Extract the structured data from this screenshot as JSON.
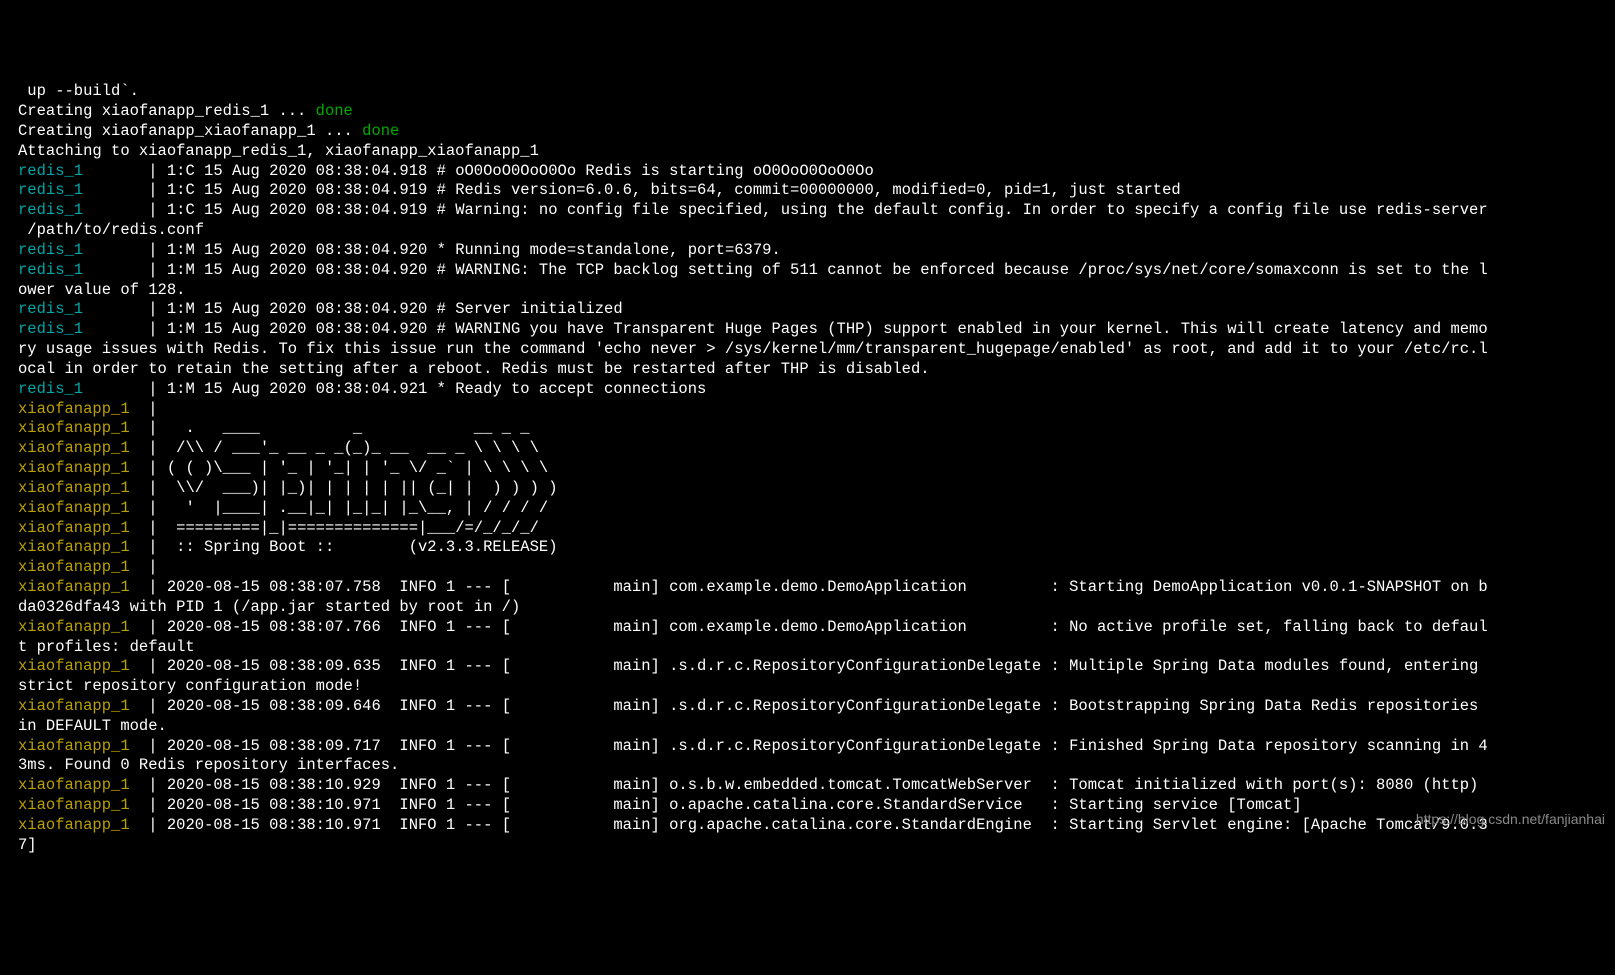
{
  "lines": [
    {
      "segments": [
        {
          "class": "white",
          "text": " up --build`."
        }
      ]
    },
    {
      "segments": [
        {
          "class": "white",
          "text": "Creating xiaofanapp_redis_1 ... "
        },
        {
          "class": "green",
          "text": "done"
        }
      ]
    },
    {
      "segments": [
        {
          "class": "white",
          "text": "Creating xiaofanapp_xiaofanapp_1 ... "
        },
        {
          "class": "green",
          "text": "done"
        }
      ]
    },
    {
      "segments": [
        {
          "class": "white",
          "text": "Attaching to xiaofanapp_redis_1, xiaofanapp_xiaofanapp_1"
        }
      ]
    },
    {
      "segments": [
        {
          "class": "cyan",
          "text": "redis_1       "
        },
        {
          "class": "pipe",
          "text": "|"
        },
        {
          "class": "white",
          "text": " 1:C 15 Aug 2020 08:38:04.918 # oO0OoO0OoO0Oo Redis is starting oO0OoO0OoO0Oo"
        }
      ]
    },
    {
      "segments": [
        {
          "class": "cyan",
          "text": "redis_1       "
        },
        {
          "class": "pipe",
          "text": "|"
        },
        {
          "class": "white",
          "text": " 1:C 15 Aug 2020 08:38:04.919 # Redis version=6.0.6, bits=64, commit=00000000, modified=0, pid=1, just started"
        }
      ]
    },
    {
      "segments": [
        {
          "class": "cyan",
          "text": "redis_1       "
        },
        {
          "class": "pipe",
          "text": "|"
        },
        {
          "class": "white",
          "text": " 1:C 15 Aug 2020 08:38:04.919 # Warning: no config file specified, using the default config. In order to specify a config file use redis-server"
        }
      ]
    },
    {
      "segments": [
        {
          "class": "white",
          "text": " /path/to/redis.conf"
        }
      ]
    },
    {
      "segments": [
        {
          "class": "cyan",
          "text": "redis_1       "
        },
        {
          "class": "pipe",
          "text": "|"
        },
        {
          "class": "white",
          "text": " 1:M 15 Aug 2020 08:38:04.920 * Running mode=standalone, port=6379."
        }
      ]
    },
    {
      "segments": [
        {
          "class": "cyan",
          "text": "redis_1       "
        },
        {
          "class": "pipe",
          "text": "|"
        },
        {
          "class": "white",
          "text": " 1:M 15 Aug 2020 08:38:04.920 # WARNING: The TCP backlog setting of 511 cannot be enforced because /proc/sys/net/core/somaxconn is set to the l"
        }
      ]
    },
    {
      "segments": [
        {
          "class": "white",
          "text": "ower value of 128."
        }
      ]
    },
    {
      "segments": [
        {
          "class": "cyan",
          "text": "redis_1       "
        },
        {
          "class": "pipe",
          "text": "|"
        },
        {
          "class": "white",
          "text": " 1:M 15 Aug 2020 08:38:04.920 # Server initialized"
        }
      ]
    },
    {
      "segments": [
        {
          "class": "cyan",
          "text": "redis_1       "
        },
        {
          "class": "pipe",
          "text": "|"
        },
        {
          "class": "white",
          "text": " 1:M 15 Aug 2020 08:38:04.920 # WARNING you have Transparent Huge Pages (THP) support enabled in your kernel. This will create latency and memo"
        }
      ]
    },
    {
      "segments": [
        {
          "class": "white",
          "text": "ry usage issues with Redis. To fix this issue run the command 'echo never > /sys/kernel/mm/transparent_hugepage/enabled' as root, and add it to your /etc/rc.l"
        }
      ]
    },
    {
      "segments": [
        {
          "class": "white",
          "text": "ocal in order to retain the setting after a reboot. Redis must be restarted after THP is disabled."
        }
      ]
    },
    {
      "segments": [
        {
          "class": "cyan",
          "text": "redis_1       "
        },
        {
          "class": "pipe",
          "text": "|"
        },
        {
          "class": "white",
          "text": " 1:M 15 Aug 2020 08:38:04.921 * Ready to accept connections"
        }
      ]
    },
    {
      "segments": [
        {
          "class": "yellow",
          "text": "xiaofanapp_1  "
        },
        {
          "class": "pipe",
          "text": "|"
        }
      ]
    },
    {
      "segments": [
        {
          "class": "yellow",
          "text": "xiaofanapp_1  "
        },
        {
          "class": "pipe",
          "text": "|"
        },
        {
          "class": "white",
          "text": "   .   ____          _            __ _ _"
        }
      ]
    },
    {
      "segments": [
        {
          "class": "yellow",
          "text": "xiaofanapp_1  "
        },
        {
          "class": "pipe",
          "text": "|"
        },
        {
          "class": "white",
          "text": "  /\\\\ / ___'_ __ _ _(_)_ __  __ _ \\ \\ \\ \\"
        }
      ]
    },
    {
      "segments": [
        {
          "class": "yellow",
          "text": "xiaofanapp_1  "
        },
        {
          "class": "pipe",
          "text": "|"
        },
        {
          "class": "white",
          "text": " ( ( )\\___ | '_ | '_| | '_ \\/ _` | \\ \\ \\ \\"
        }
      ]
    },
    {
      "segments": [
        {
          "class": "yellow",
          "text": "xiaofanapp_1  "
        },
        {
          "class": "pipe",
          "text": "|"
        },
        {
          "class": "white",
          "text": "  \\\\/  ___)| |_)| | | | | || (_| |  ) ) ) )"
        }
      ]
    },
    {
      "segments": [
        {
          "class": "yellow",
          "text": "xiaofanapp_1  "
        },
        {
          "class": "pipe",
          "text": "|"
        },
        {
          "class": "white",
          "text": "   '  |____| .__|_| |_|_| |_\\__, | / / / /"
        }
      ]
    },
    {
      "segments": [
        {
          "class": "yellow",
          "text": "xiaofanapp_1  "
        },
        {
          "class": "pipe",
          "text": "|"
        },
        {
          "class": "white",
          "text": "  =========|_|==============|___/=/_/_/_/"
        }
      ]
    },
    {
      "segments": [
        {
          "class": "yellow",
          "text": "xiaofanapp_1  "
        },
        {
          "class": "pipe",
          "text": "|"
        },
        {
          "class": "white",
          "text": "  :: Spring Boot ::        (v2.3.3.RELEASE)"
        }
      ]
    },
    {
      "segments": [
        {
          "class": "yellow",
          "text": "xiaofanapp_1  "
        },
        {
          "class": "pipe",
          "text": "|"
        }
      ]
    },
    {
      "segments": [
        {
          "class": "yellow",
          "text": "xiaofanapp_1  "
        },
        {
          "class": "pipe",
          "text": "|"
        },
        {
          "class": "white",
          "text": " 2020-08-15 08:38:07.758  INFO 1 --- [           main] com.example.demo.DemoApplication         : Starting DemoApplication v0.0.1-SNAPSHOT on b"
        }
      ]
    },
    {
      "segments": [
        {
          "class": "white",
          "text": "da0326dfa43 with PID 1 (/app.jar started by root in /)"
        }
      ]
    },
    {
      "segments": [
        {
          "class": "yellow",
          "text": "xiaofanapp_1  "
        },
        {
          "class": "pipe",
          "text": "|"
        },
        {
          "class": "white",
          "text": " 2020-08-15 08:38:07.766  INFO 1 --- [           main] com.example.demo.DemoApplication         : No active profile set, falling back to defaul"
        }
      ]
    },
    {
      "segments": [
        {
          "class": "white",
          "text": "t profiles: default"
        }
      ]
    },
    {
      "segments": [
        {
          "class": "yellow",
          "text": "xiaofanapp_1  "
        },
        {
          "class": "pipe",
          "text": "|"
        },
        {
          "class": "white",
          "text": " 2020-08-15 08:38:09.635  INFO 1 --- [           main] .s.d.r.c.RepositoryConfigurationDelegate : Multiple Spring Data modules found, entering "
        }
      ]
    },
    {
      "segments": [
        {
          "class": "white",
          "text": "strict repository configuration mode!"
        }
      ]
    },
    {
      "segments": [
        {
          "class": "yellow",
          "text": "xiaofanapp_1  "
        },
        {
          "class": "pipe",
          "text": "|"
        },
        {
          "class": "white",
          "text": " 2020-08-15 08:38:09.646  INFO 1 --- [           main] .s.d.r.c.RepositoryConfigurationDelegate : Bootstrapping Spring Data Redis repositories "
        }
      ]
    },
    {
      "segments": [
        {
          "class": "white",
          "text": "in DEFAULT mode."
        }
      ]
    },
    {
      "segments": [
        {
          "class": "yellow",
          "text": "xiaofanapp_1  "
        },
        {
          "class": "pipe",
          "text": "|"
        },
        {
          "class": "white",
          "text": " 2020-08-15 08:38:09.717  INFO 1 --- [           main] .s.d.r.c.RepositoryConfigurationDelegate : Finished Spring Data repository scanning in 4"
        }
      ]
    },
    {
      "segments": [
        {
          "class": "white",
          "text": "3ms. Found 0 Redis repository interfaces."
        }
      ]
    },
    {
      "segments": [
        {
          "class": "yellow",
          "text": "xiaofanapp_1  "
        },
        {
          "class": "pipe",
          "text": "|"
        },
        {
          "class": "white",
          "text": " 2020-08-15 08:38:10.929  INFO 1 --- [           main] o.s.b.w.embedded.tomcat.TomcatWebServer  : Tomcat initialized with port(s): 8080 (http)"
        }
      ]
    },
    {
      "segments": [
        {
          "class": "yellow",
          "text": "xiaofanapp_1  "
        },
        {
          "class": "pipe",
          "text": "|"
        },
        {
          "class": "white",
          "text": " 2020-08-15 08:38:10.971  INFO 1 --- [           main] o.apache.catalina.core.StandardService   : Starting service [Tomcat]"
        }
      ]
    },
    {
      "segments": [
        {
          "class": "yellow",
          "text": "xiaofanapp_1  "
        },
        {
          "class": "pipe",
          "text": "|"
        },
        {
          "class": "white",
          "text": " 2020-08-15 08:38:10.971  INFO 1 --- [           main] org.apache.catalina.core.StandardEngine  : Starting Servlet engine: [Apache Tomcat/9.0.3"
        }
      ]
    },
    {
      "segments": [
        {
          "class": "white",
          "text": "7]"
        }
      ]
    }
  ],
  "watermark": "https://blog.csdn.net/fanjianhai"
}
